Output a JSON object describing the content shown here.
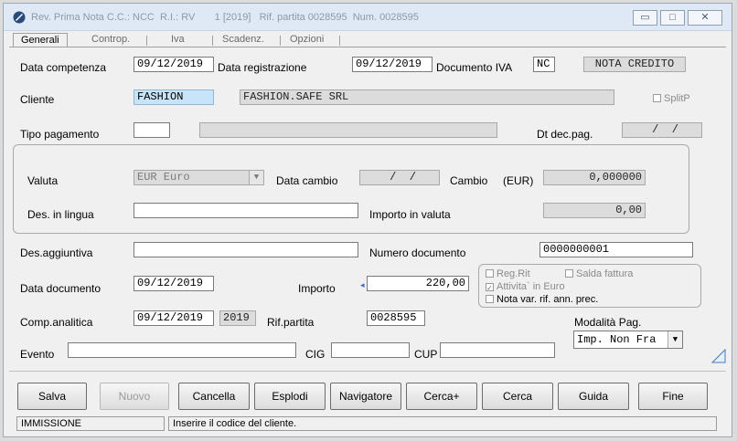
{
  "window": {
    "title": "Rev. Prima Nota C.C.: NCC  R.I.: RV       1 [2019]   Rif. partita 0028595  Num. 0028595",
    "minimize": "▭",
    "maximize": "□",
    "close": "✕"
  },
  "tabs": [
    {
      "label": "Generali"
    },
    {
      "label": "Controp."
    },
    {
      "label": "Iva"
    },
    {
      "label": "Scadenz."
    },
    {
      "label": "Opzioni"
    }
  ],
  "form": {
    "data_competenza_label": "Data competenza",
    "data_competenza": "09/12/2019",
    "data_registrazione_label": "Data registrazione",
    "data_registrazione": "09/12/2019",
    "documento_iva_label": "Documento IVA",
    "documento_iva_code": "NC",
    "documento_iva_desc": "NOTA CREDITO",
    "cliente_label": "Cliente",
    "cliente_code": "FASHION",
    "cliente_name": "FASHION.SAFE SRL",
    "splitp_label": "SplitP",
    "tipo_pagamento_label": "Tipo pagamento",
    "tipo_pagamento_code": "",
    "tipo_pagamento_desc": "",
    "dt_dec_pag_label": "Dt dec.pag.",
    "dt_dec_pag": " /  /",
    "valuta_label": "Valuta",
    "valuta": "EUR Euro",
    "data_cambio_label": "Data cambio",
    "data_cambio": " /  /",
    "cambio_label": "Cambio",
    "cambio_unit": "(EUR)",
    "cambio": "0,000000",
    "des_lingua_label": "Des. in lingua",
    "des_lingua": "",
    "importo_valuta_label": "Importo in valuta",
    "importo_valuta": "0,00",
    "des_aggiuntiva_label": "Des.aggiuntiva",
    "des_aggiuntiva": "",
    "numero_documento_label": "Numero documento",
    "numero_documento": "0000000001",
    "data_documento_label": "Data documento",
    "data_documento": "09/12/2019",
    "importo_label": "Importo",
    "importo": "220,00",
    "reg_rit_label": "Reg.Rit",
    "salda_fattura_label": "Salda fattura",
    "attivita_euro_label": "Attivita` in Euro",
    "nota_var_label": "Nota var. rif. ann. prec.",
    "comp_analitica_label": "Comp.analitica",
    "comp_analitica": "09/12/2019",
    "comp_anno": "2019",
    "rif_partita_label": "Rif.partita",
    "rif_partita": "0028595",
    "modalita_pag_label": "Modalità Pag.",
    "modalita_pag": "Imp. Non Fra",
    "evento_label": "Evento",
    "evento": "",
    "cig_label": "CIG",
    "cig": "",
    "cup_label": "CUP",
    "cup": ""
  },
  "buttons": {
    "salva": "Salva",
    "nuovo": "Nuovo",
    "cancella": "Cancella",
    "esplodi": "Esplodi",
    "navigatore": "Navigatore",
    "cerca_plus": "Cerca+",
    "cerca": "Cerca",
    "guida": "Guida",
    "fine": "Fine"
  },
  "status": {
    "mode": "IMMISSIONE",
    "message": "Inserire il codice del cliente."
  },
  "colors": {
    "highlight_field": "#c8e4f8",
    "readonly_field": "#dcdcdc",
    "titlebar": "#dfe9f5"
  }
}
